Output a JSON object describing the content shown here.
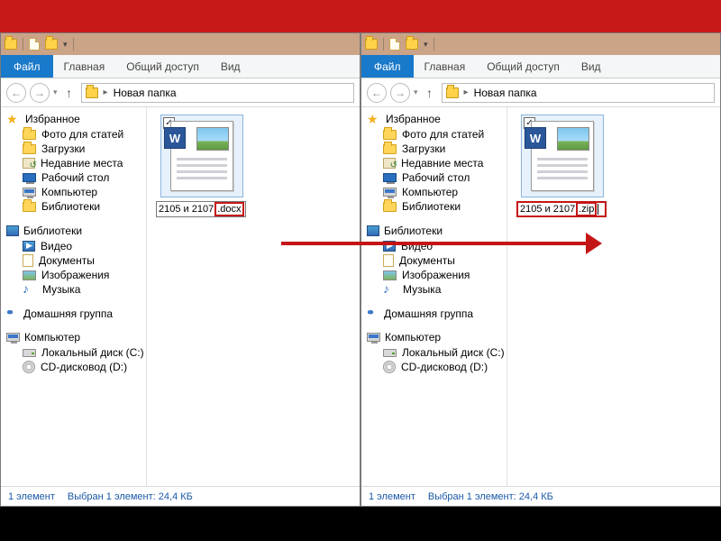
{
  "ribbon": {
    "file": "Файл",
    "tabs": [
      "Главная",
      "Общий доступ",
      "Вид"
    ]
  },
  "breadcrumb": "Новая папка",
  "left": {
    "favorites_hdr": "Избранное",
    "favorites": [
      "Фото для статей",
      "Загрузки",
      "Недавние места",
      "Рабочий стол",
      "Компьютер",
      "Библиотеки"
    ],
    "libraries_hdr": "Библиотеки",
    "libraries": [
      "Видео",
      "Документы",
      "Изображения",
      "Музыка"
    ],
    "homegroup": "Домашняя группа",
    "computer_hdr": "Компьютер",
    "drives": [
      "Локальный диск (C:)",
      "CD-дисковод (D:)"
    ],
    "file_base": "2105 и 2107",
    "file_ext": ".docx"
  },
  "right": {
    "file_base": "2105 и 2107",
    "file_ext": ".zip"
  },
  "status": {
    "count": "1 элемент",
    "selected": "Выбран 1 элемент: 24,4 КБ"
  }
}
